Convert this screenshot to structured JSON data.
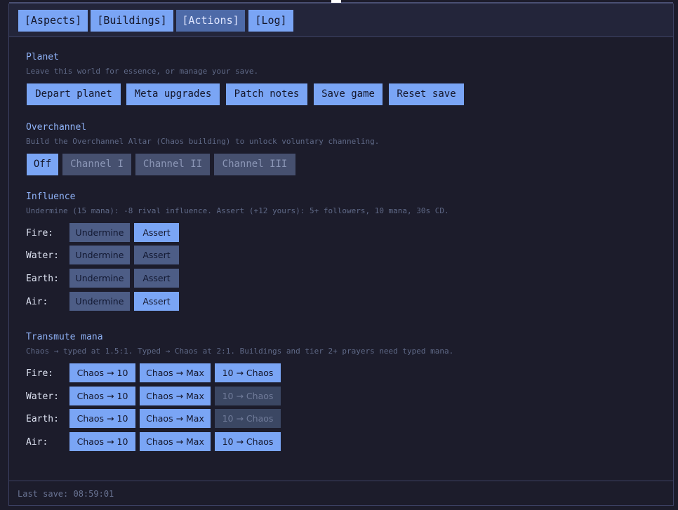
{
  "tabs": [
    "[Aspects]",
    "[Buildings]",
    "[Actions]",
    "[Log]"
  ],
  "planet": {
    "title": "Planet",
    "description": "Leave this world for essence, or manage your save.",
    "buttons": [
      "Depart planet",
      "Meta upgrades",
      "Patch notes",
      "Save game",
      "Reset save"
    ]
  },
  "overchannel": {
    "title": "Overchannel",
    "description": "Build the Overchannel Altar (Chaos building) to unlock voluntary channeling.",
    "options": [
      "Off",
      "Channel I",
      "Channel II",
      "Channel III"
    ],
    "selected": "Off"
  },
  "influence": {
    "title": "Influence",
    "description": "Undermine (15 mana): -8 rival influence. Assert (+12 yours): 5+ followers, 10 mana, 30s CD.",
    "rows": [
      {
        "label": "Fire:",
        "undermine": "Undermine",
        "assert": "Assert"
      },
      {
        "label": "Water:",
        "undermine": "Undermine",
        "assert": "Assert"
      },
      {
        "label": "Earth:",
        "undermine": "Undermine",
        "assert": "Assert"
      },
      {
        "label": "Air:",
        "undermine": "Undermine",
        "assert": "Assert"
      }
    ]
  },
  "transmute": {
    "title": "Transmute mana",
    "description": "Chaos → typed at 1.5:1. Typed → Chaos at 2:1. Buildings and tier 2+ prayers need typed mana.",
    "rows": [
      {
        "label": "Fire:",
        "to10": "Chaos → 10",
        "toMax": "Chaos → Max",
        "back": "10 → Chaos"
      },
      {
        "label": "Water:",
        "to10": "Chaos → 10",
        "toMax": "Chaos → Max",
        "back": "10 → Chaos"
      },
      {
        "label": "Earth:",
        "to10": "Chaos → 10",
        "toMax": "Chaos → Max",
        "back": "10 → Chaos"
      },
      {
        "label": "Air:",
        "to10": "Chaos → 10",
        "toMax": "Chaos → Max",
        "back": "10 → Chaos"
      }
    ]
  },
  "footer": {
    "last_save": "Last save: 08:59:01"
  }
}
